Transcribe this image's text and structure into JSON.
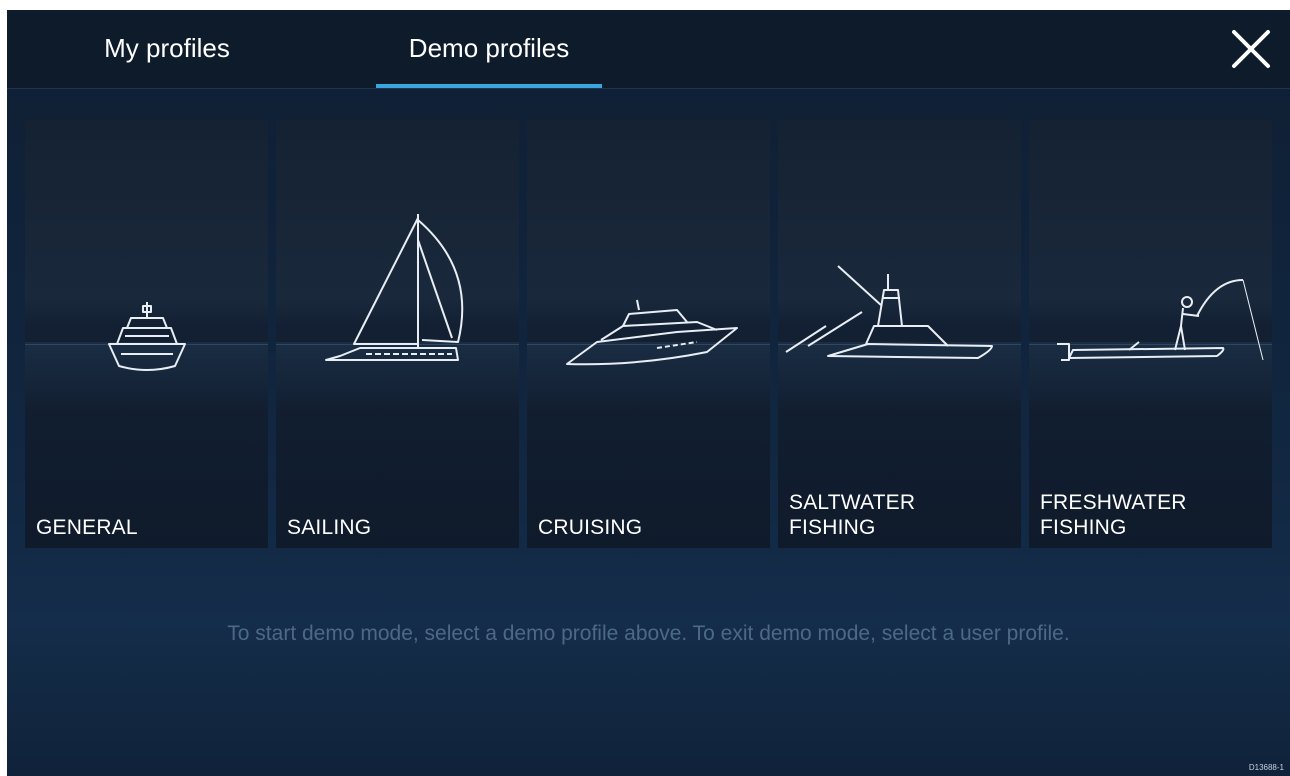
{
  "tabs": [
    {
      "label": "My profiles",
      "active": false
    },
    {
      "label": "Demo profiles",
      "active": true
    }
  ],
  "icons": {
    "close": "close-icon"
  },
  "colors": {
    "accent": "#3aa6e0",
    "background": "#112640",
    "hint_text": "#4d6985"
  },
  "profiles": [
    {
      "label": "GENERAL",
      "icon": "motorboat-icon"
    },
    {
      "label": "SAILING",
      "icon": "sailboat-icon"
    },
    {
      "label": "CRUISING",
      "icon": "cruiser-icon"
    },
    {
      "label": "SALTWATER\nFISHING",
      "icon": "sportfishing-boat-icon"
    },
    {
      "label": "FRESHWATER\nFISHING",
      "icon": "angler-boat-icon"
    }
  ],
  "hint": "To start demo mode, select a demo profile above. To exit demo mode, select a user profile.",
  "figure_code": "D13688-1"
}
